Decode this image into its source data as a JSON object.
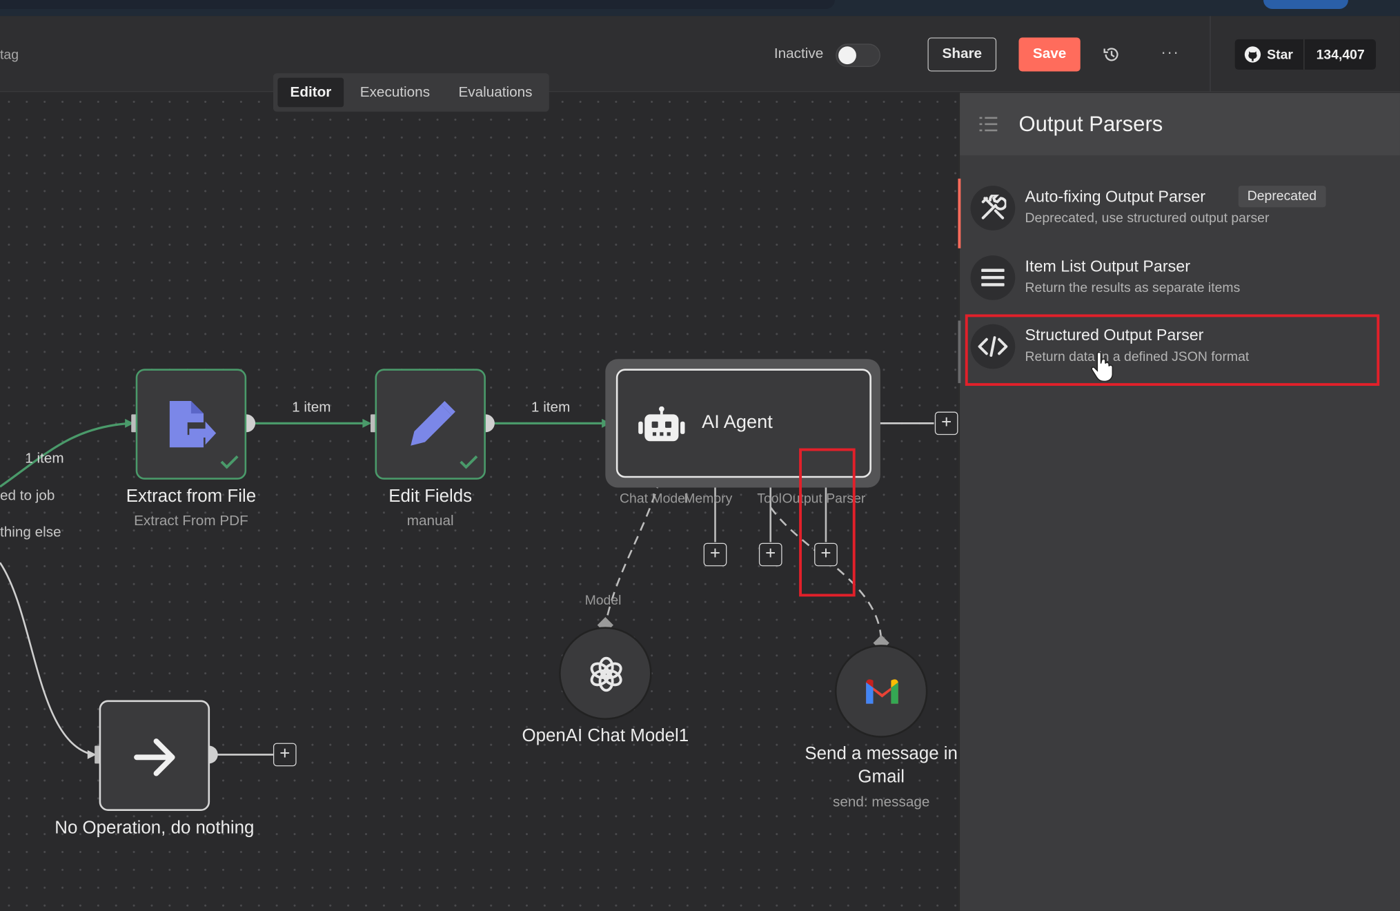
{
  "header": {
    "tag_text": "tag",
    "inactive_label": "Inactive",
    "share_label": "Share",
    "save_label": "Save",
    "more_label": "···",
    "github": {
      "star_label": "Star",
      "count": "134,407"
    }
  },
  "tabs": [
    {
      "label": "Editor",
      "active": true
    },
    {
      "label": "Executions",
      "active": false
    },
    {
      "label": "Evaluations",
      "active": false
    }
  ],
  "canvas": {
    "edge_labels": {
      "left_item": "1 item",
      "extract_to_edit": "1 item",
      "edit_to_agent": "1 item"
    },
    "left_cut_texts": [
      "ed to job",
      "thing else"
    ],
    "nodes": {
      "extract": {
        "title": "Extract from File",
        "subtitle": "Extract From PDF"
      },
      "edit": {
        "title": "Edit Fields",
        "subtitle": "manual"
      },
      "agent": {
        "title": "AI Agent",
        "ports": [
          "Chat Model",
          "Memory",
          "Tool",
          "Output Parser"
        ]
      },
      "openai": {
        "title": "OpenAI Chat Model1",
        "port_label": "Model"
      },
      "gmail": {
        "title_line1": "Send a message in",
        "title_line2": "Gmail",
        "subtitle": "send: message"
      },
      "noop": {
        "title": "No Operation, do nothing"
      }
    }
  },
  "panel": {
    "title": "Output Parsers",
    "items": [
      {
        "name": "Auto-fixing Output Parser",
        "badge": "Deprecated",
        "description": "Deprecated, use structured output parser",
        "icon": "tools-icon"
      },
      {
        "name": "Item List Output Parser",
        "description": "Return the results as separate items",
        "icon": "list-icon"
      },
      {
        "name": "Structured Output Parser",
        "description": "Return data in a defined JSON format",
        "icon": "code-icon"
      }
    ]
  },
  "colors": {
    "accent": "#ff6c5c",
    "success": "#4a9a6a",
    "highlight": "#e2202a",
    "node_icon_blue": "#7b87e8"
  }
}
